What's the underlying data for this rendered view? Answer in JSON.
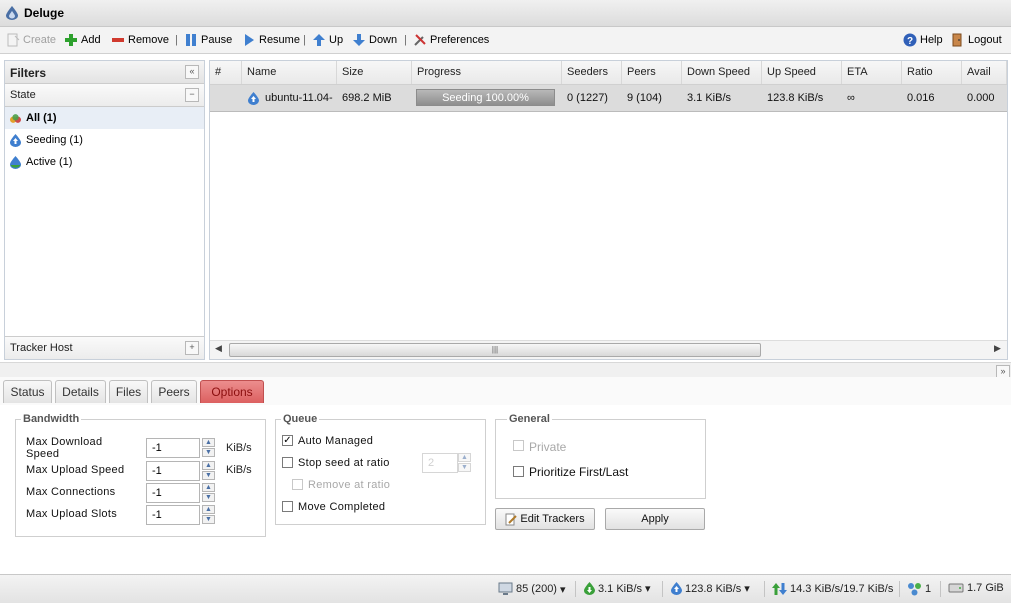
{
  "app": {
    "title": "Deluge"
  },
  "toolbar": {
    "create": "Create",
    "add": "Add",
    "remove": "Remove",
    "pause": "Pause",
    "resume": "Resume",
    "up": "Up",
    "down": "Down",
    "preferences": "Preferences",
    "help": "Help",
    "logout": "Logout"
  },
  "filters": {
    "title": "Filters",
    "state_label": "State",
    "items": [
      {
        "label": "All (1)"
      },
      {
        "label": "Seeding (1)"
      },
      {
        "label": "Active (1)"
      }
    ],
    "tracker_host_label": "Tracker Host"
  },
  "grid": {
    "columns": [
      "#",
      "Name",
      "Size",
      "Progress",
      "Seeders",
      "Peers",
      "Down Speed",
      "Up Speed",
      "ETA",
      "Ratio",
      "Avail"
    ],
    "rows": [
      {
        "num": "",
        "name": "ubuntu-11.04-",
        "size": "698.2 MiB",
        "progress_text": "Seeding 100.00%",
        "progress": 1.0,
        "seeders": "0 (1227)",
        "peers": "9 (104)",
        "down_speed": "3.1 KiB/s",
        "up_speed": "123.8 KiB/s",
        "eta": "∞",
        "ratio": "0.016",
        "avail": "0.000"
      }
    ]
  },
  "tabs": [
    {
      "label": "Status"
    },
    {
      "label": "Details"
    },
    {
      "label": "Files"
    },
    {
      "label": "Peers"
    },
    {
      "label": "Options",
      "active": true
    }
  ],
  "options": {
    "bandwidth": {
      "legend": "Bandwidth",
      "max_download_label": "Max Download Speed",
      "max_download_value": "-1",
      "max_upload_label": "Max Upload Speed",
      "max_upload_value": "-1",
      "max_connections_label": "Max Connections",
      "max_connections_value": "-1",
      "max_upload_slots_label": "Max Upload Slots",
      "max_upload_slots_value": "-1",
      "unit": "KiB/s"
    },
    "queue": {
      "legend": "Queue",
      "auto_managed_label": "Auto Managed",
      "auto_managed": true,
      "stop_seed_label": "Stop seed at ratio",
      "stop_seed": false,
      "stop_seed_ratio": "2",
      "remove_at_ratio_label": "Remove at ratio",
      "move_completed_label": "Move Completed"
    },
    "general": {
      "legend": "General",
      "private_label": "Private",
      "prioritize_label": "Prioritize First/Last"
    },
    "edit_trackers": "Edit Trackers",
    "apply": "Apply"
  },
  "statusbar": {
    "connections": "85 (200)",
    "download": "3.1 KiB/s",
    "upload": "123.8 KiB/s",
    "protocol": "14.3 KiB/s/19.7 KiB/s",
    "dht": "1",
    "disk": "1.7 GiB"
  }
}
